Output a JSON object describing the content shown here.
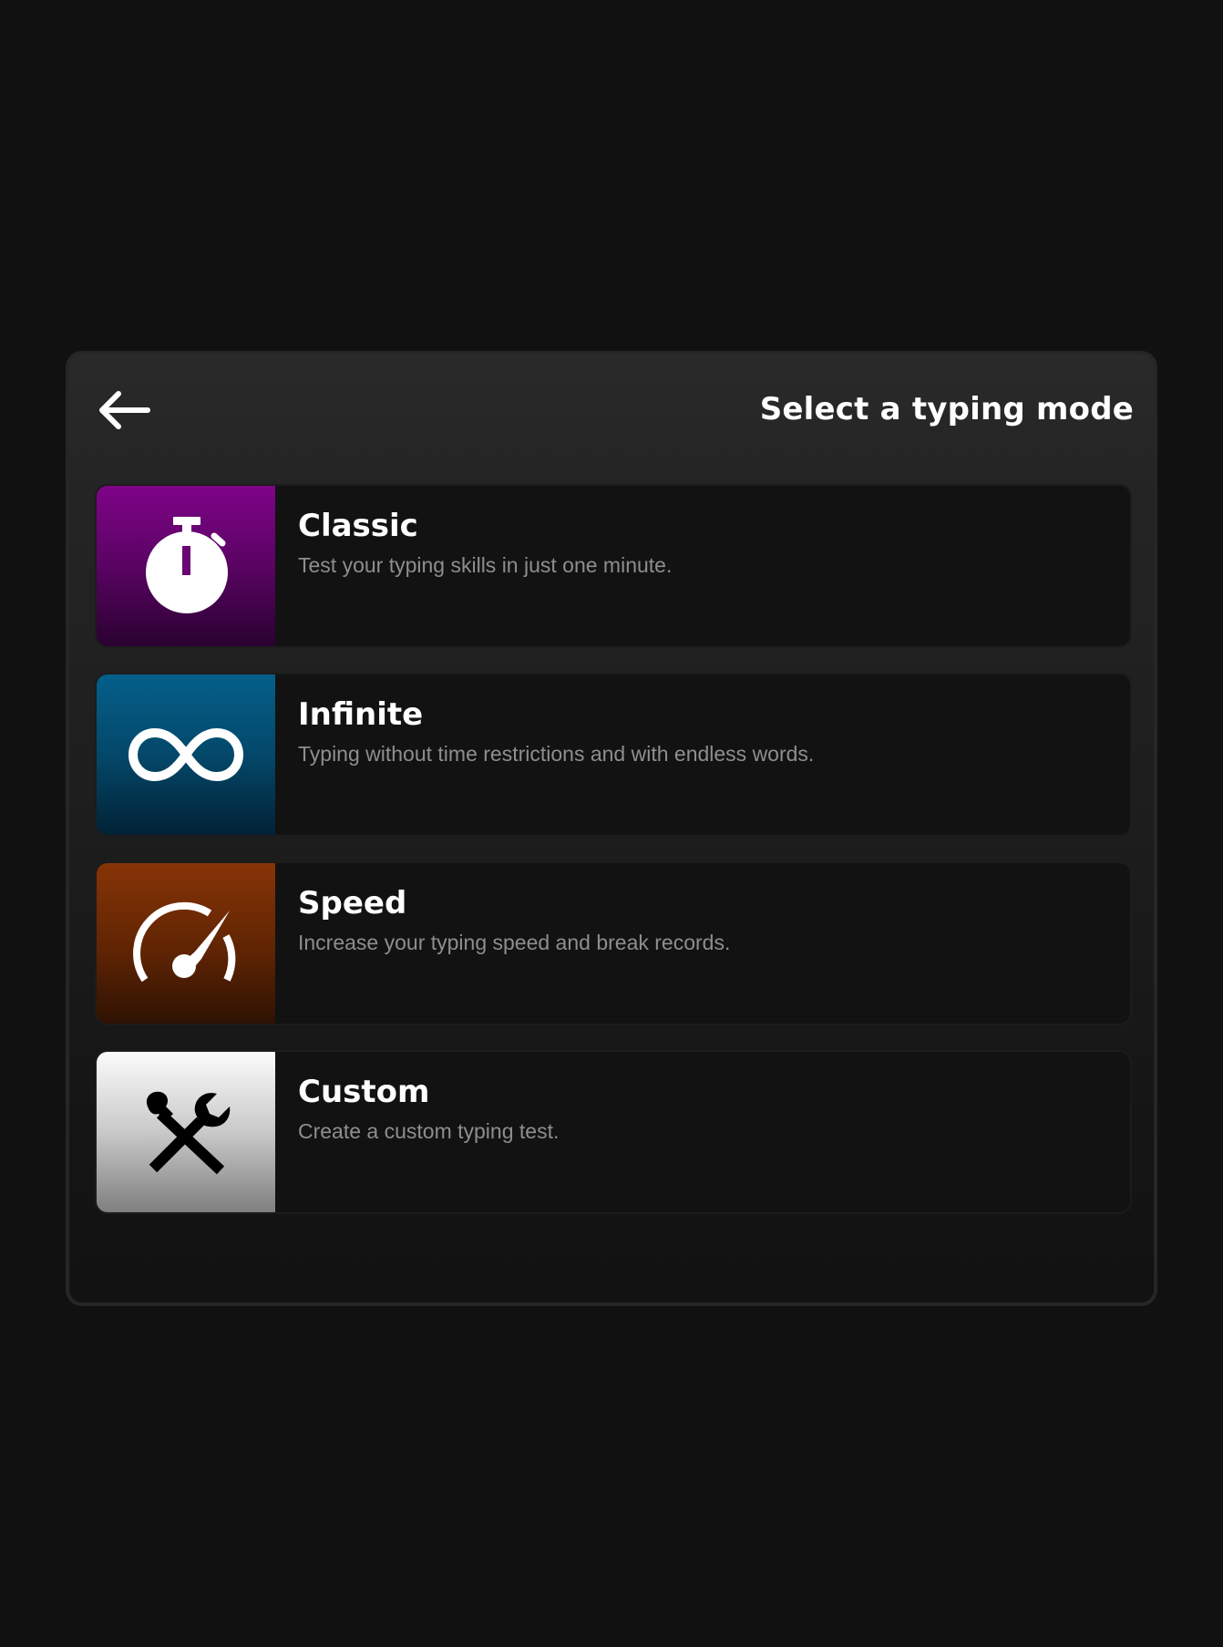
{
  "header": {
    "title": "Select a typing mode",
    "back_icon": "arrow-left-icon"
  },
  "modes": [
    {
      "id": "classic",
      "name": "Classic",
      "description": "Test your typing skills in just one minute.",
      "icon": "stopwatch-icon",
      "color_top": "#7e0488",
      "color_bottom": "#2a0230"
    },
    {
      "id": "infinite",
      "name": "Infinite",
      "description": "Typing without time restrictions and with endless words.",
      "icon": "infinity-icon",
      "color_top": "#045f8a",
      "color_bottom": "#022236"
    },
    {
      "id": "speed",
      "name": "Speed",
      "description": "Increase your typing speed and break records.",
      "icon": "speedometer-icon",
      "color_top": "#873406",
      "color_bottom": "#2e1202"
    },
    {
      "id": "custom",
      "name": "Custom",
      "description": "Create a custom typing test.",
      "icon": "tools-icon",
      "color_top": "#fbfbfb",
      "color_bottom": "#7f7f7f"
    }
  ]
}
